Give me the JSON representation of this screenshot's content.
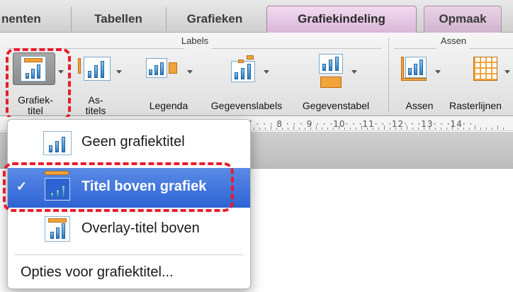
{
  "tabs": {
    "items": [
      {
        "label": "nenten"
      },
      {
        "label": "Tabellen"
      },
      {
        "label": "Grafieken"
      },
      {
        "label": "Grafiekindeling"
      },
      {
        "label": "Opmaak"
      }
    ],
    "active_index": 3
  },
  "ribbon": {
    "groups": [
      {
        "label": "Labels"
      },
      {
        "label": "Assen"
      }
    ],
    "buttons": [
      {
        "label_line1": "Grafiek-",
        "label_line2": "titel",
        "icon": "chart-title-icon",
        "pressed": true
      },
      {
        "label_line1": "As-",
        "label_line2": "titels",
        "icon": "axis-titles-icon"
      },
      {
        "label": "Legenda",
        "icon": "legend-icon"
      },
      {
        "label": "Gegevenslabels",
        "icon": "data-labels-icon"
      },
      {
        "label": "Gegevenstabel",
        "icon": "data-table-icon"
      },
      {
        "label": "Assen",
        "icon": "axes-icon"
      },
      {
        "label": "Rasterlijnen",
        "icon": "gridlines-icon"
      }
    ]
  },
  "ruler": {
    "text": "7 · · · 8 · · · 9 · · ·10· · ·11· · ·12· · ·13· · ·14· ·"
  },
  "menu": {
    "items": [
      {
        "label": "Geen grafiektitel",
        "icon": "no-chart-title-icon",
        "selected": false
      },
      {
        "label": "Titel boven grafiek",
        "icon": "title-above-chart-icon",
        "selected": true,
        "check": "✓"
      },
      {
        "label": "Overlay-titel boven",
        "icon": "overlay-title-icon",
        "selected": false
      }
    ],
    "options_label": "Opties voor grafiektitel..."
  },
  "colors": {
    "accent_selected": "#2e63d4",
    "highlight_ring": "#e81c2c",
    "active_tab": "#d9b6d8"
  }
}
